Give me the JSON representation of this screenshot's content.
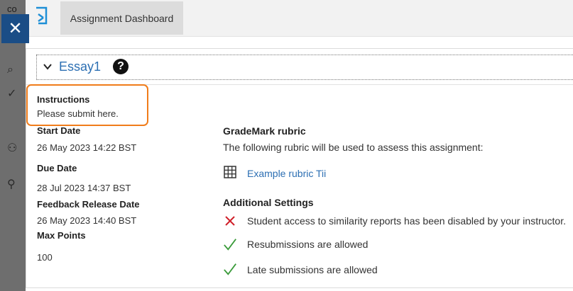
{
  "background": {
    "partial_text": "co"
  },
  "topbar": {
    "tab_label": "Assignment Dashboard"
  },
  "assignment": {
    "title": "Essay1",
    "help_glyph": "?",
    "instructions_label": "Instructions",
    "instructions_text": "Please submit here.",
    "start_date_label": "Start Date",
    "start_date": "26 May 2023 14:22 BST",
    "due_date_label": "Due Date",
    "due_date": "28 Jul 2023 14:37 BST",
    "feedback_label": "Feedback Release Date",
    "feedback_date": "26 May 2023 14:40 BST",
    "max_points_label": "Max Points",
    "max_points": "100"
  },
  "rubric": {
    "heading": "GradeMark rubric",
    "description": "The following rubric will be used to assess this assignment:",
    "link_text": "Example rubric Tii"
  },
  "additional": {
    "heading": "Additional Settings",
    "items": [
      {
        "text": "Student access to similarity reports has been disabled by your instructor.",
        "status": "disabled",
        "icon": "cross-icon",
        "color": "#d0202a"
      },
      {
        "text": "Resubmissions are allowed",
        "status": "allowed",
        "icon": "check-icon",
        "color": "#3a9b3a"
      },
      {
        "text": "Late submissions are allowed",
        "status": "allowed",
        "icon": "check-icon",
        "color": "#3a9b3a"
      }
    ]
  },
  "colors": {
    "accent": "#2c6fb3",
    "close_button": "#1a4d86",
    "highlight": "#f07c1a"
  }
}
